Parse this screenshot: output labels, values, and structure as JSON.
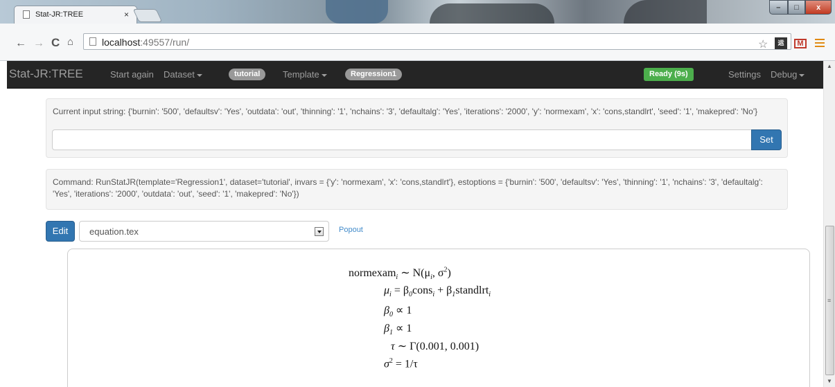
{
  "browser": {
    "tab_title": "Stat-JR:TREE",
    "tab_close": "×",
    "url_host": "localhost",
    "url_rest": ":49557/run/",
    "ext_icon_text": "运",
    "ext_mail_text": "M",
    "window_buttons": {
      "min": "–",
      "max": "□",
      "close": "x"
    }
  },
  "navbar": {
    "brand": "Stat-JR:TREE",
    "start_again": "Start again",
    "dataset": "Dataset",
    "dataset_badge": "tutorial",
    "template": "Template",
    "template_badge": "Regression1",
    "status": "Ready (9s)",
    "settings": "Settings",
    "debug": "Debug"
  },
  "input_panel": {
    "current_string": "Current input string: {'burnin': '500', 'defaultsv': 'Yes', 'outdata': 'out', 'thinning': '1', 'nchains': '3', 'defaultalg': 'Yes', 'iterations': '2000', 'y': 'normexam', 'x': 'cons,standlrt', 'seed': '1', 'makepred': 'No'}",
    "input_value": "",
    "set_label": "Set"
  },
  "command_panel": {
    "command": "Command: RunStatJR(template='Regression1', dataset='tutorial', invars = {'y': 'normexam', 'x': 'cons,standlrt'}, estoptions = {'burnin': '500', 'defaultsv': 'Yes', 'thinning': '1', 'nchains': '3', 'defaultalg': 'Yes', 'iterations': '2000', 'outdata': 'out', 'seed': '1', 'makepred': 'No'})"
  },
  "editor": {
    "edit_label": "Edit",
    "selected_file": "equation.tex",
    "popout_label": "Popout"
  },
  "equations": {
    "l1_lhs": "normexam",
    "l1_sub": "i",
    "l1_rhs": " ∼ N(μ",
    "l1_sub2": "i",
    "l1_tail": ", σ",
    "l1_sup": "2",
    "l1_end": ")",
    "l2_lhs": "μ",
    "l2_sub": "i",
    "l2_mid": " = β",
    "l2_sub0": "0",
    "l2_cons": "cons",
    "l2_subi": "i",
    "l2_plus": " + β",
    "l2_sub1": "1",
    "l2_std": "standlrt",
    "l2_subi2": "i",
    "l3_lhs": "β",
    "l3_sub": "0",
    "l3_rhs": " ∝ 1",
    "l4_lhs": "β",
    "l4_sub": "1",
    "l4_rhs": " ∝ 1",
    "l5_lhs": "τ",
    "l5_rhs": " ∼ Γ(0.001, 0.001)",
    "l6_lhs": "σ",
    "l6_sup": "2",
    "l6_rhs": " = 1/τ"
  }
}
